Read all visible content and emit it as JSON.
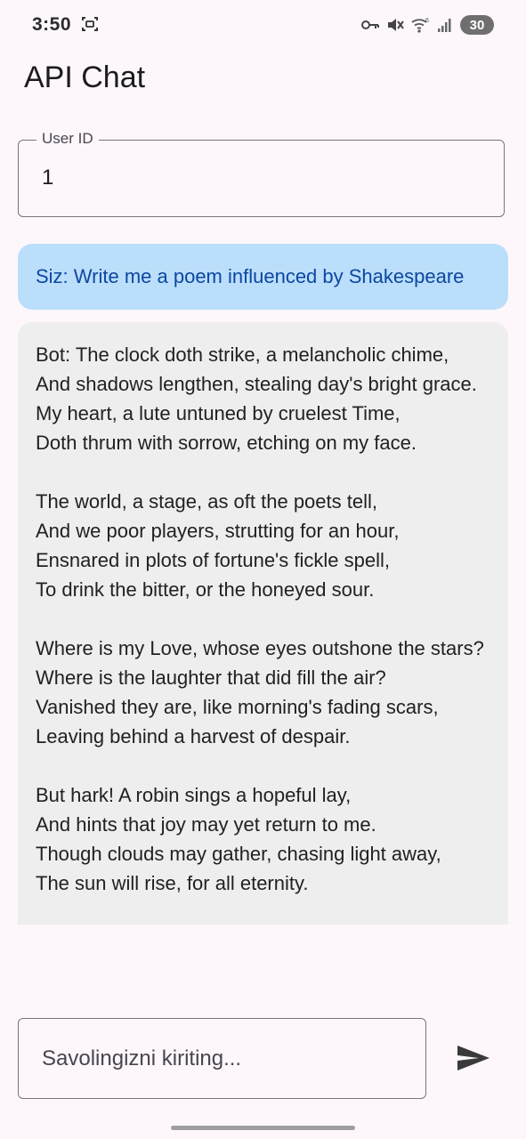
{
  "status_bar": {
    "time": "3:50",
    "battery_level": "30",
    "icons": [
      "screenshot-icon",
      "key-icon",
      "mute-icon",
      "wifi-icon",
      "signal-icon"
    ]
  },
  "app_bar": {
    "title": "API Chat"
  },
  "user_id_field": {
    "label": "User ID",
    "value": "1"
  },
  "messages": [
    {
      "sender": "user",
      "text": "Siz: Write me a poem influenced by Shakespeare"
    },
    {
      "sender": "bot",
      "text": "Bot: The clock doth strike, a melancholic chime,\nAnd shadows lengthen, stealing day's bright grace.\nMy heart, a lute untuned by cruelest Time,\nDoth thrum with sorrow, etching on my face.\n\nThe world, a stage, as oft the poets tell,\nAnd we poor players, strutting for an hour,\nEnsnared in plots of fortune's fickle spell,\nTo drink the bitter, or the honeyed sour.\n\nWhere is my Love, whose eyes outshone the stars?\nWhere is the laughter that did fill the air?\nVanished they are, like morning's fading scars,\nLeaving behind a harvest of despair.\n\nBut hark! A robin sings a hopeful lay,\nAnd hints that joy may yet return to me.\nThough clouds may gather, chasing light away,\nThe sun will rise, for all eternity."
    }
  ],
  "composer": {
    "placeholder": "Savolingizni kiriting...",
    "value": "",
    "send_icon": "send-icon"
  },
  "colors": {
    "background": "#fdf7fc",
    "user_bubble": "#bbdefb",
    "user_text": "#0d47a1",
    "bot_bubble": "#eeeeee",
    "bot_text": "#212121",
    "outline": "#79747e"
  }
}
